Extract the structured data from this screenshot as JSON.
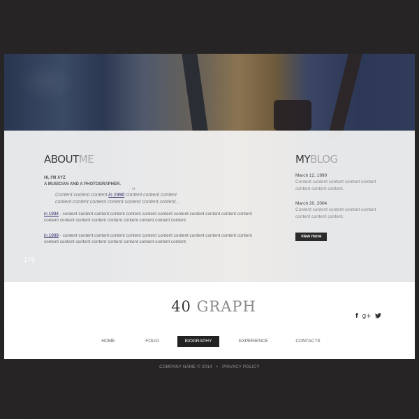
{
  "slider": {
    "counter": "1/6"
  },
  "about": {
    "title_strong": "ABOUT",
    "title_light": "ME",
    "intro_line1": "HI, I'M XYZ",
    "intro_line2": "A MUSICIAN AND A PHOTOGRAPHER.",
    "quote_before": "Content content content",
    "quote_link": "in 1990",
    "quote_after": "content content content content content content content content content content...",
    "quote_mark": "“",
    "history": [
      {
        "year": "in 1994",
        "text": " - content content content content content content content content content content content content content content content content content content content content content."
      },
      {
        "year": "in 1999",
        "text": " - content content content content content content content content content content content content content content content content content content content content content."
      }
    ]
  },
  "blog": {
    "title_strong": "MY",
    "title_light": "BLOG",
    "posts": [
      {
        "date": "March 12, 1999",
        "text": "Content content content content content content content content."
      },
      {
        "date": "March 20, 2004",
        "text": "Content content content content content content content content."
      }
    ],
    "view_more": "view more"
  },
  "logo": {
    "number": "40",
    "word": "GRAPH"
  },
  "social": {
    "facebook": "f",
    "googleplus": "g+",
    "twitter": "🐦"
  },
  "nav": {
    "items": [
      {
        "label": "HOME",
        "active": false
      },
      {
        "label": "FOLIO",
        "active": false
      },
      {
        "label": "BIOGRAPHY",
        "active": true
      },
      {
        "label": "EXPERIENCE",
        "active": false
      },
      {
        "label": "CONTACTS",
        "active": false
      }
    ]
  },
  "footer": {
    "company": "COMPANY NAME © 2014",
    "separator": "•",
    "privacy": "PRIVACY POLICY"
  }
}
